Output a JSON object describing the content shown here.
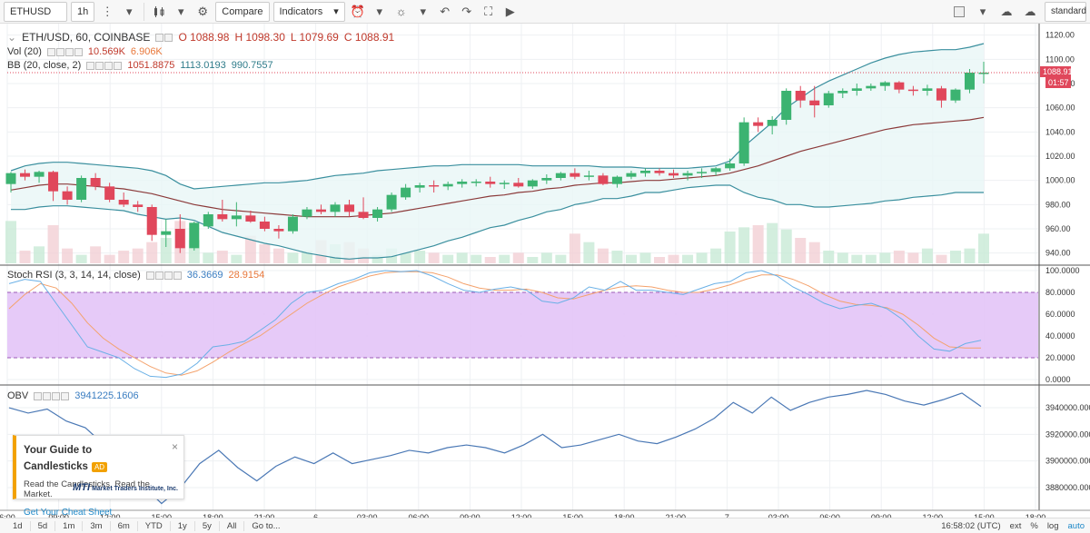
{
  "toolbar": {
    "symbol": "ETHUSD",
    "interval": "1h",
    "compare_label": "Compare",
    "indicators_label": "Indicators",
    "layout_label": "standard"
  },
  "legend": {
    "main": {
      "title": "ETH/USD, 60, COINBASE",
      "o": "O 1088.98",
      "h": "H 1098.30",
      "l": "L 1079.69",
      "c": "C 1088.91"
    },
    "vol": {
      "label": "Vol (20)",
      "v1": "10.569K",
      "v2": "6.906K"
    },
    "bb": {
      "label": "BB (20, close, 2)",
      "v1": "1051.8875",
      "v2": "1113.0193",
      "v3": "990.7557"
    },
    "rsi": {
      "label": "Stoch RSI (3, 3, 14, 14, close)",
      "v1": "36.3669",
      "v2": "28.9154"
    },
    "obv": {
      "label": "OBV",
      "v1": "3941225.1606"
    }
  },
  "price_tags": {
    "last": "1088.91",
    "countdown": "01:57"
  },
  "ad": {
    "title": "Your Guide to Candlesticks",
    "badge": "AD",
    "close": "×",
    "subtitle": "Read the Candlesticks, Read the Market.",
    "link": "Get Your Cheat Sheet",
    "logo_mark": "MTI",
    "logo_text": "Market Traders Institute, Inc."
  },
  "bottom": {
    "ranges": [
      "1d",
      "5d",
      "1m",
      "3m",
      "6m",
      "YTD",
      "1y",
      "5y",
      "All"
    ],
    "goto": "Go to...",
    "clock": "16:58:02 (UTC)",
    "ext": "ext",
    "pct": "%",
    "log": "log",
    "auto": "auto"
  },
  "colors": {
    "up": "#3cb371",
    "down": "#e0475b",
    "bb_band": "#3a8f9e",
    "bb_mid": "#8b3a3a",
    "rsi_k": "#6ab0e6",
    "rsi_d": "#f4a26c",
    "rsi_fill": "#e3c4f7",
    "obv": "#4a78b5"
  },
  "chart_data": {
    "type": "candlestick",
    "x_tick_labels": [
      "6:00",
      "09:00",
      "12:00",
      "15:00",
      "18:00",
      "21:00",
      "6",
      "03:00",
      "06:00",
      "09:00",
      "12:00",
      "15:00",
      "18:00",
      "21:00",
      "7",
      "03:00",
      "06:00",
      "09:00",
      "12:00",
      "15:00",
      "18:00"
    ],
    "price_axis": {
      "ticks": [
        1120,
        1100,
        1080,
        1060,
        1040,
        1020,
        1000,
        980,
        960,
        940
      ],
      "ylim": [
        930,
        1125
      ]
    },
    "candles": [
      {
        "o": 997,
        "h": 1007,
        "l": 990,
        "c": 1006
      },
      {
        "o": 1006,
        "h": 1009,
        "l": 1000,
        "c": 1003
      },
      {
        "o": 1003,
        "h": 1008,
        "l": 998,
        "c": 1007
      },
      {
        "o": 1007,
        "h": 1008,
        "l": 983,
        "c": 991
      },
      {
        "o": 991,
        "h": 995,
        "l": 980,
        "c": 984
      },
      {
        "o": 984,
        "h": 1004,
        "l": 982,
        "c": 1002
      },
      {
        "o": 1002,
        "h": 1006,
        "l": 992,
        "c": 995
      },
      {
        "o": 995,
        "h": 998,
        "l": 982,
        "c": 984
      },
      {
        "o": 984,
        "h": 990,
        "l": 978,
        "c": 980
      },
      {
        "o": 980,
        "h": 983,
        "l": 974,
        "c": 978
      },
      {
        "o": 978,
        "h": 980,
        "l": 950,
        "c": 955
      },
      {
        "o": 955,
        "h": 968,
        "l": 945,
        "c": 958
      },
      {
        "o": 960,
        "h": 972,
        "l": 940,
        "c": 944
      },
      {
        "o": 944,
        "h": 966,
        "l": 942,
        "c": 965
      },
      {
        "o": 962,
        "h": 974,
        "l": 960,
        "c": 972
      },
      {
        "o": 972,
        "h": 984,
        "l": 966,
        "c": 968
      },
      {
        "o": 968,
        "h": 982,
        "l": 962,
        "c": 971
      },
      {
        "o": 971,
        "h": 975,
        "l": 965,
        "c": 966
      },
      {
        "o": 966,
        "h": 970,
        "l": 958,
        "c": 960
      },
      {
        "o": 960,
        "h": 963,
        "l": 952,
        "c": 958
      },
      {
        "o": 958,
        "h": 972,
        "l": 956,
        "c": 970
      },
      {
        "o": 970,
        "h": 978,
        "l": 968,
        "c": 976
      },
      {
        "o": 976,
        "h": 980,
        "l": 972,
        "c": 974
      },
      {
        "o": 974,
        "h": 982,
        "l": 970,
        "c": 980
      },
      {
        "o": 980,
        "h": 984,
        "l": 970,
        "c": 974
      },
      {
        "o": 974,
        "h": 986,
        "l": 968,
        "c": 969
      },
      {
        "o": 969,
        "h": 978,
        "l": 966,
        "c": 976
      },
      {
        "o": 976,
        "h": 990,
        "l": 974,
        "c": 988
      },
      {
        "o": 986,
        "h": 997,
        "l": 984,
        "c": 994
      },
      {
        "o": 994,
        "h": 998,
        "l": 990,
        "c": 996
      },
      {
        "o": 996,
        "h": 1000,
        "l": 990,
        "c": 995
      },
      {
        "o": 995,
        "h": 999,
        "l": 992,
        "c": 997
      },
      {
        "o": 997,
        "h": 1001,
        "l": 994,
        "c": 999
      },
      {
        "o": 999,
        "h": 1001,
        "l": 995,
        "c": 999
      },
      {
        "o": 999,
        "h": 1003,
        "l": 994,
        "c": 997
      },
      {
        "o": 997,
        "h": 1000,
        "l": 993,
        "c": 998
      },
      {
        "o": 998,
        "h": 1002,
        "l": 994,
        "c": 995
      },
      {
        "o": 995,
        "h": 1001,
        "l": 993,
        "c": 1000
      },
      {
        "o": 1000,
        "h": 1005,
        "l": 997,
        "c": 1002
      },
      {
        "o": 1002,
        "h": 1007,
        "l": 1000,
        "c": 1006
      },
      {
        "o": 1006,
        "h": 1010,
        "l": 1001,
        "c": 1003
      },
      {
        "o": 1003,
        "h": 1008,
        "l": 1000,
        "c": 1004
      },
      {
        "o": 1004,
        "h": 1006,
        "l": 996,
        "c": 997
      },
      {
        "o": 997,
        "h": 1004,
        "l": 994,
        "c": 1003
      },
      {
        "o": 1003,
        "h": 1008,
        "l": 1001,
        "c": 1006
      },
      {
        "o": 1006,
        "h": 1010,
        "l": 1003,
        "c": 1008
      },
      {
        "o": 1008,
        "h": 1010,
        "l": 1004,
        "c": 1006
      },
      {
        "o": 1006,
        "h": 1009,
        "l": 1002,
        "c": 1004
      },
      {
        "o": 1004,
        "h": 1008,
        "l": 1000,
        "c": 1006
      },
      {
        "o": 1006,
        "h": 1010,
        "l": 1002,
        "c": 1007
      },
      {
        "o": 1007,
        "h": 1011,
        "l": 1004,
        "c": 1010
      },
      {
        "o": 1010,
        "h": 1018,
        "l": 1008,
        "c": 1014
      },
      {
        "o": 1014,
        "h": 1052,
        "l": 1012,
        "c": 1048
      },
      {
        "o": 1048,
        "h": 1052,
        "l": 1040,
        "c": 1045
      },
      {
        "o": 1045,
        "h": 1053,
        "l": 1038,
        "c": 1050
      },
      {
        "o": 1050,
        "h": 1076,
        "l": 1046,
        "c": 1074
      },
      {
        "o": 1074,
        "h": 1078,
        "l": 1060,
        "c": 1066
      },
      {
        "o": 1066,
        "h": 1078,
        "l": 1052,
        "c": 1062
      },
      {
        "o": 1062,
        "h": 1074,
        "l": 1060,
        "c": 1072
      },
      {
        "o": 1072,
        "h": 1076,
        "l": 1068,
        "c": 1074
      },
      {
        "o": 1074,
        "h": 1080,
        "l": 1070,
        "c": 1076
      },
      {
        "o": 1076,
        "h": 1080,
        "l": 1074,
        "c": 1078
      },
      {
        "o": 1078,
        "h": 1082,
        "l": 1074,
        "c": 1081
      },
      {
        "o": 1081,
        "h": 1082,
        "l": 1072,
        "c": 1075
      },
      {
        "o": 1075,
        "h": 1078,
        "l": 1070,
        "c": 1074
      },
      {
        "o": 1074,
        "h": 1079,
        "l": 1070,
        "c": 1076
      },
      {
        "o": 1076,
        "h": 1078,
        "l": 1060,
        "c": 1066
      },
      {
        "o": 1066,
        "h": 1076,
        "l": 1064,
        "c": 1075
      },
      {
        "o": 1075,
        "h": 1092,
        "l": 1072,
        "c": 1089
      },
      {
        "o": 1089,
        "h": 1098,
        "l": 1080,
        "c": 1089
      }
    ],
    "bollinger": {
      "upper": [
        1008,
        1012,
        1014,
        1015,
        1015,
        1014,
        1013,
        1012,
        1011,
        1010,
        1008,
        1004,
        997,
        993,
        994,
        995,
        996,
        997,
        998,
        998,
        999,
        1000,
        1002,
        1004,
        1005,
        1006,
        1008,
        1009,
        1010,
        1011,
        1012,
        1012,
        1013,
        1013,
        1013,
        1013,
        1013,
        1012,
        1012,
        1012,
        1012,
        1012,
        1011,
        1011,
        1011,
        1010,
        1010,
        1010,
        1010,
        1011,
        1012,
        1016,
        1028,
        1038,
        1048,
        1060,
        1068,
        1076,
        1082,
        1087,
        1092,
        1097,
        1101,
        1104,
        1106,
        1107,
        1108,
        1108,
        1110,
        1113
      ],
      "middle": [
        992,
        994,
        996,
        997,
        997,
        996,
        995,
        994,
        993,
        991,
        989,
        986,
        983,
        980,
        978,
        976,
        975,
        974,
        973,
        972,
        971,
        970,
        970,
        970,
        970,
        971,
        972,
        973,
        975,
        977,
        979,
        981,
        983,
        985,
        987,
        988,
        990,
        991,
        993,
        994,
        996,
        997,
        998,
        998,
        999,
        1000,
        1000,
        1001,
        1002,
        1003,
        1004,
        1006,
        1009,
        1012,
        1016,
        1020,
        1024,
        1027,
        1030,
        1033,
        1036,
        1039,
        1042,
        1044,
        1046,
        1047,
        1048,
        1049,
        1050,
        1052
      ],
      "lower": [
        976,
        976,
        978,
        979,
        979,
        978,
        977,
        976,
        975,
        972,
        970,
        968,
        969,
        967,
        962,
        957,
        954,
        951,
        948,
        946,
        943,
        940,
        938,
        936,
        935,
        936,
        936,
        937,
        940,
        943,
        946,
        950,
        953,
        957,
        961,
        963,
        967,
        970,
        974,
        976,
        980,
        982,
        985,
        985,
        987,
        990,
        990,
        992,
        994,
        995,
        996,
        996,
        990,
        986,
        984,
        980,
        980,
        978,
        978,
        979,
        980,
        981,
        983,
        984,
        986,
        987,
        988,
        990,
        990,
        990
      ]
    },
    "volume": [
      40,
      12,
      16,
      36,
      14,
      8,
      16,
      8,
      12,
      14,
      20,
      24,
      40,
      22,
      10,
      12,
      8,
      26,
      18,
      14,
      10,
      12,
      22,
      18,
      20,
      14,
      8,
      14,
      10,
      12,
      10,
      8,
      10,
      8,
      6,
      8,
      10,
      6,
      10,
      8,
      28,
      20,
      14,
      12,
      8,
      10,
      6,
      8,
      8,
      10,
      14,
      30,
      34,
      36,
      38,
      32,
      24,
      20,
      12,
      10,
      8,
      8,
      10,
      12,
      10,
      14,
      8,
      12,
      14,
      28
    ],
    "stoch_rsi": {
      "ylim": [
        0,
        100
      ],
      "ticks": [
        100,
        80,
        60,
        40,
        20,
        0
      ],
      "bands": [
        80,
        20
      ],
      "k": [
        88,
        92,
        90,
        70,
        50,
        30,
        25,
        20,
        10,
        3,
        2,
        5,
        15,
        30,
        32,
        35,
        45,
        55,
        70,
        80,
        82,
        88,
        92,
        98,
        100,
        99,
        100,
        95,
        88,
        82,
        80,
        83,
        85,
        82,
        72,
        70,
        75,
        85,
        82,
        90,
        82,
        82,
        80,
        78,
        83,
        88,
        90,
        98,
        100,
        95,
        85,
        78,
        70,
        65,
        68,
        70,
        65,
        55,
        40,
        28,
        26,
        33,
        36
      ],
      "d": [
        65,
        78,
        88,
        84,
        70,
        52,
        38,
        28,
        20,
        12,
        6,
        4,
        8,
        16,
        25,
        33,
        40,
        50,
        60,
        70,
        78,
        85,
        90,
        95,
        98,
        99,
        99,
        98,
        94,
        88,
        84,
        82,
        82,
        83,
        80,
        75,
        74,
        78,
        82,
        85,
        86,
        85,
        82,
        80,
        80,
        83,
        87,
        92,
        96,
        96,
        92,
        86,
        78,
        72,
        69,
        68,
        66,
        60,
        50,
        38,
        30,
        29,
        29
      ]
    },
    "obv": {
      "ticks": [
        3940000,
        3920000,
        3900000,
        3880000
      ],
      "ylim": [
        3867000,
        3953000
      ],
      "values": [
        3940000,
        3936000,
        3939000,
        3930000,
        3925000,
        3912000,
        3896000,
        3882000,
        3868000,
        3880000,
        3898000,
        3908000,
        3895000,
        3885000,
        3896000,
        3903000,
        3898000,
        3906000,
        3898000,
        3901000,
        3904000,
        3908000,
        3906000,
        3910000,
        3912000,
        3910000,
        3906000,
        3912000,
        3920000,
        3910000,
        3912000,
        3916000,
        3920000,
        3915000,
        3913000,
        3918000,
        3924000,
        3932000,
        3944000,
        3936000,
        3948000,
        3938000,
        3944000,
        3948000,
        3950000,
        3953000,
        3950000,
        3945000,
        3942000,
        3946000,
        3951000,
        3941000
      ]
    }
  }
}
